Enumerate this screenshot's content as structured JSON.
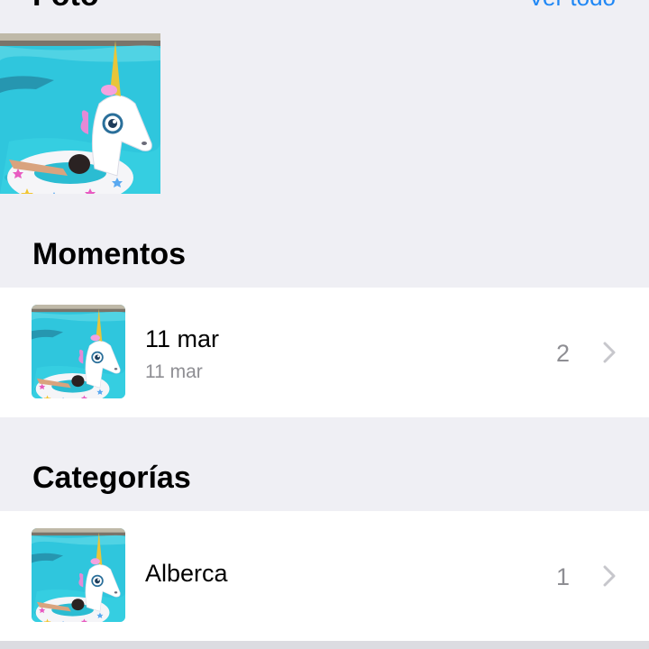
{
  "header": {
    "title": "Foto",
    "see_all": "Ver todo"
  },
  "photos": [
    {
      "alt": "unicorn-float-photo"
    }
  ],
  "moments": {
    "title": "Momentos",
    "items": [
      {
        "title": "11 mar",
        "subtitle": "11 mar",
        "count": "2"
      }
    ]
  },
  "categories": {
    "title": "Categorías",
    "items": [
      {
        "title": "Alberca",
        "count": "1"
      }
    ]
  },
  "colors": {
    "accent": "#1f87f5",
    "background": "#efeff4",
    "secondary_text": "#8e8e93",
    "chevron": "#c7c7cc"
  }
}
